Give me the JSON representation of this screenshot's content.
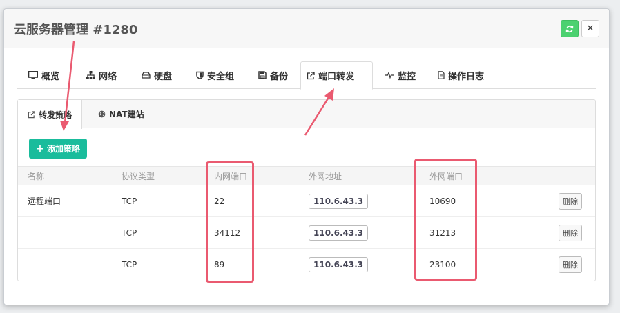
{
  "modal": {
    "title": "云服务器管理 #1280"
  },
  "tabs": [
    {
      "label": "概览",
      "icon": "monitor-icon"
    },
    {
      "label": "网络",
      "icon": "network-icon"
    },
    {
      "label": "硬盘",
      "icon": "hdd-icon"
    },
    {
      "label": "安全组",
      "icon": "shield-icon"
    },
    {
      "label": "备份",
      "icon": "save-icon"
    },
    {
      "label": "端口转发",
      "icon": "external-link-icon",
      "active": true
    },
    {
      "label": "监控",
      "icon": "pulse-icon"
    },
    {
      "label": "操作日志",
      "icon": "file-icon"
    }
  ],
  "subtabs": [
    {
      "label": "转发策略",
      "icon": "external-link-icon",
      "active": true
    },
    {
      "label": "NAT建站",
      "icon": "globe-icon"
    }
  ],
  "add_button": {
    "label": "添加策略"
  },
  "table": {
    "headers": [
      "名称",
      "协议类型",
      "内网端口",
      "外网地址",
      "外网端口"
    ],
    "rows": [
      {
        "name": "远程端口",
        "protocol": "TCP",
        "internal_port": "22",
        "external_address": "110.6.43.3",
        "external_port": "10690",
        "action": "删除"
      },
      {
        "name": "",
        "protocol": "TCP",
        "internal_port": "34112",
        "external_address": "110.6.43.3",
        "external_port": "31213",
        "action": "删除"
      },
      {
        "name": "",
        "protocol": "TCP",
        "internal_port": "89",
        "external_address": "110.6.43.3",
        "external_port": "23100",
        "action": "删除"
      }
    ]
  },
  "colors": {
    "accent": "#1abc9c",
    "refresh": "#4cd170",
    "highlight": "#ea5a70"
  }
}
